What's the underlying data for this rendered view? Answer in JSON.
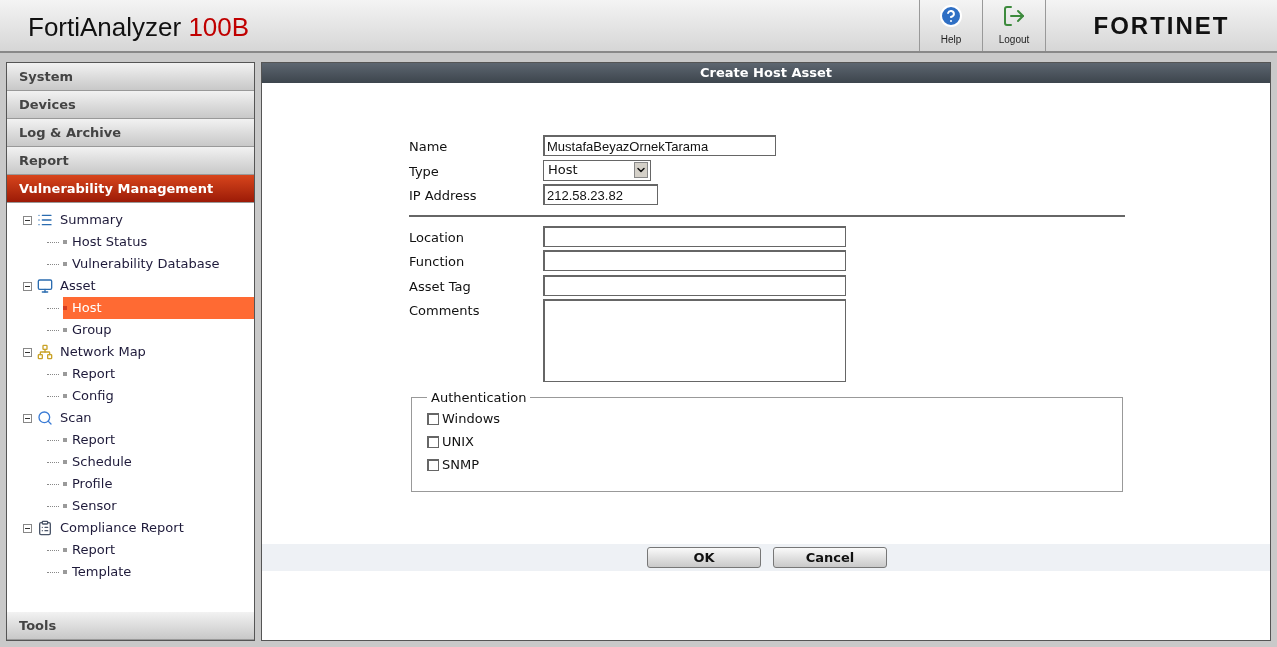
{
  "header": {
    "product": "FortiAnalyzer",
    "model": "100B",
    "buttons": [
      {
        "kind": "help",
        "label": "Help"
      },
      {
        "kind": "logout",
        "label": "Logout"
      }
    ],
    "brand": "FORTINET"
  },
  "sidebar": {
    "sections": [
      {
        "label": "System",
        "selected": false
      },
      {
        "label": "Devices",
        "selected": false
      },
      {
        "label": "Log & Archive",
        "selected": false
      },
      {
        "label": "Report",
        "selected": false
      },
      {
        "label": "Vulnerability Management",
        "selected": true
      }
    ],
    "tree": [
      {
        "label": "Summary",
        "kind": "summary",
        "expanded": true,
        "children": [
          {
            "label": "Host Status",
            "selected": false
          },
          {
            "label": "Vulnerability Database",
            "selected": false
          }
        ]
      },
      {
        "label": "Asset",
        "kind": "asset",
        "expanded": true,
        "children": [
          {
            "label": "Host",
            "selected": true
          },
          {
            "label": "Group",
            "selected": false
          }
        ]
      },
      {
        "label": "Network Map",
        "kind": "map",
        "expanded": true,
        "children": [
          {
            "label": "Report",
            "selected": false
          },
          {
            "label": "Config",
            "selected": false
          }
        ]
      },
      {
        "label": "Scan",
        "kind": "scan",
        "expanded": true,
        "children": [
          {
            "label": "Report",
            "selected": false
          },
          {
            "label": "Schedule",
            "selected": false
          },
          {
            "label": "Profile",
            "selected": false
          },
          {
            "label": "Sensor",
            "selected": false
          }
        ]
      },
      {
        "label": "Compliance Report",
        "kind": "compliance",
        "expanded": true,
        "children": [
          {
            "label": "Report",
            "selected": false
          },
          {
            "label": "Template",
            "selected": false
          }
        ]
      }
    ],
    "footer": {
      "label": "Tools",
      "selected": false
    }
  },
  "panel": {
    "title": "Create Host Asset",
    "fields": [
      {
        "label": "Name",
        "kind": "text",
        "value": "MustafaBeyazOrnekTarama"
      },
      {
        "label": "Type",
        "kind": "select",
        "value": "Host"
      },
      {
        "label": "IP Address",
        "kind": "text",
        "value": "212.58.23.82"
      },
      {
        "kind": "rule"
      },
      {
        "label": "Location",
        "kind": "text"
      },
      {
        "label": "Function",
        "kind": "text"
      },
      {
        "label": "Asset Tag",
        "kind": "text"
      },
      {
        "label": "Comments",
        "kind": "textarea"
      }
    ],
    "authentication": {
      "legend": "Authentication",
      "options": [
        {
          "label": "Windows",
          "checked": false
        },
        {
          "label": "UNIX",
          "checked": false
        },
        {
          "label": "SNMP",
          "checked": false
        }
      ]
    },
    "buttons": [
      "OK",
      "Cancel"
    ]
  }
}
